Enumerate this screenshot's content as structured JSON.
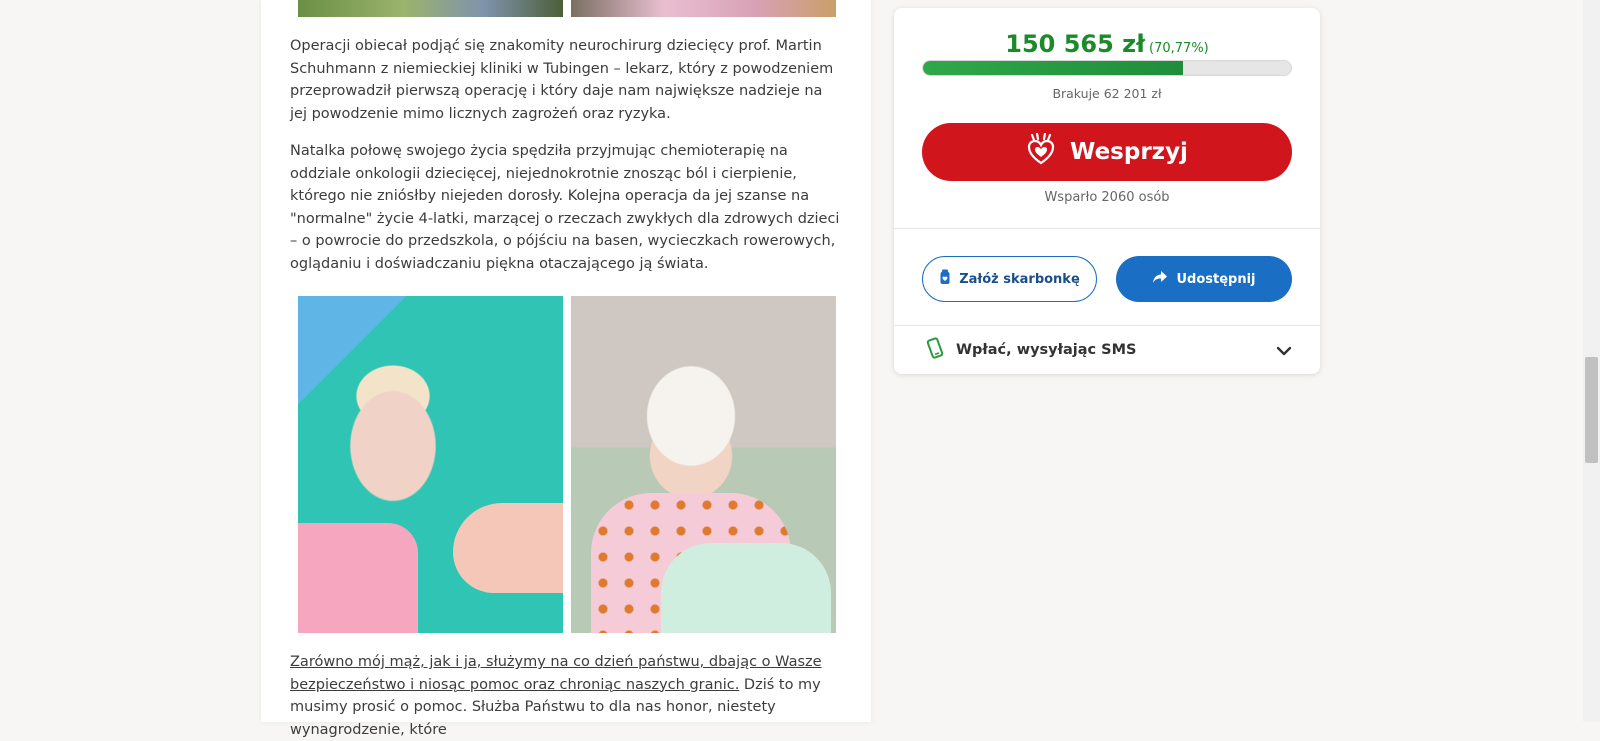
{
  "article": {
    "paragraph1": "Operacji obiecał podjąć się znakomity neurochirurg dziecięcy prof. Martin Schuhmann z niemieckiej kliniki w Tubingen – lekarz, który z powodzeniem przeprowadził pierwszą operację i który daje nam największe nadzieje na jej powodzenie mimo licznych zagrożeń oraz ryzyka.",
    "paragraph2": "Natalka połowę swojego życia spędziła przyjmując chemioterapię na oddziale onkologii dziecięcej, niejednokrotnie znosząc ból i cierpienie, którego nie zniósłby niejeden dorosły. Kolejna operacja da jej szanse na \"normalne\" życie 4-latki, marzącej o rzeczach zwykłych dla zdrowych dzieci – o powrocie do przedszkola, o pójściu na basen, wycieczkach rowerowych, oglądaniu i doświadczaniu piękna otaczającego ją świata.",
    "paragraph3_underlined": "Zarówno mój mąż, jak i ja, służymy na co dzień państwu, dbając o Wasze bezpieczeństwo i niosąc pomoc oraz chroniąc naszych granic.",
    "paragraph3_rest": " Dziś to my musimy prosić o pomoc. Służba Państwu to dla nas honor, niestety wynagrodzenie, które"
  },
  "fundraiser": {
    "amount": "150 565 zł",
    "percent_label": "(70,77%)",
    "progress_fraction": 0.7077,
    "missing": "Brakuje 62 201 zł",
    "donate_label": "Wesprzyj",
    "donors": "Wsparło 2060 osób",
    "piggybank_label": "Załóż skarbonkę",
    "share_label": "Udostępnij",
    "sms_label": "Wpłać, wysyłając SMS"
  },
  "colors": {
    "accent_green": "#1a8a2a",
    "donate_red": "#d0151c",
    "primary_blue": "#1a6fc4"
  }
}
